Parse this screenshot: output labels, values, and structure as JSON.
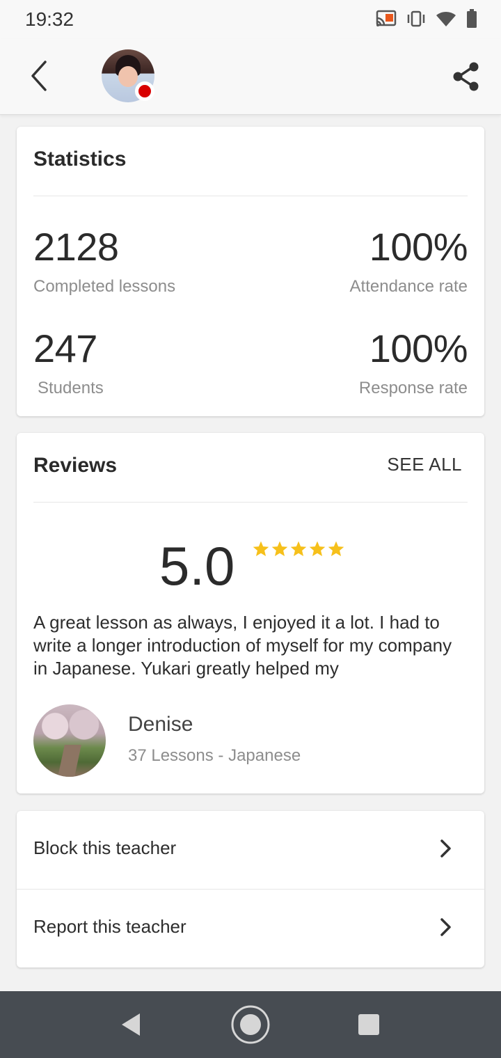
{
  "status_bar": {
    "time": "19:32",
    "icons": [
      "cast-icon",
      "vibrate-icon",
      "wifi-icon",
      "battery-icon"
    ]
  },
  "app_bar": {
    "back_icon": "chevron-left-icon",
    "share_icon": "share-icon",
    "online_status_color": "#d80000"
  },
  "statistics": {
    "title": "Statistics",
    "items": [
      {
        "value": "2128",
        "label": "Completed lessons"
      },
      {
        "value": "100%",
        "label": "Attendance rate"
      },
      {
        "value": "247",
        "label": "Students"
      },
      {
        "value": "100%",
        "label": "Response rate"
      }
    ]
  },
  "reviews": {
    "title": "Reviews",
    "see_all_label": "SEE ALL",
    "rating": "5.0",
    "stars": 5,
    "star_color": "#f6c01b",
    "review_text": "A great lesson as always, I enjoyed it a lot. I had to write a longer introduction of myself for my company in Japanese. Yukari greatly helped my",
    "reviewer": {
      "name": "Denise",
      "meta": "37 Lessons - Japanese"
    }
  },
  "actions": [
    {
      "label": "Block this teacher"
    },
    {
      "label": "Report this teacher"
    }
  ],
  "nav_bar": {
    "icons": [
      "back-triangle-icon",
      "home-circle-icon",
      "recents-square-icon"
    ]
  }
}
